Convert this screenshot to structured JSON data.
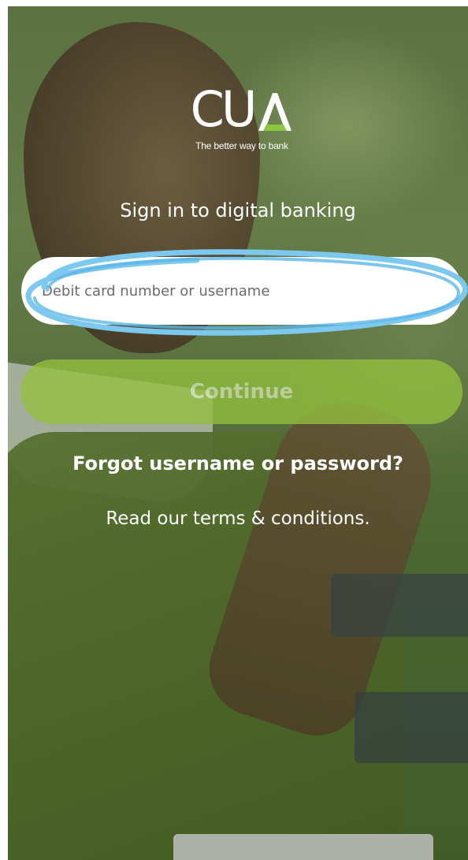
{
  "brand": {
    "logo_text": "CU",
    "logo_accent_letter": "A",
    "tagline": "The better way to bank",
    "accent_color": "#8dc63f"
  },
  "login": {
    "heading": "Sign in to digital banking",
    "username_placeholder": "Debit card number or username",
    "continue_label": "Continue",
    "forgot_label": "Forgot username or password?",
    "terms_label": "Read our terms & conditions."
  },
  "annotation": {
    "color": "#7cc8ee",
    "target": "username-input"
  }
}
